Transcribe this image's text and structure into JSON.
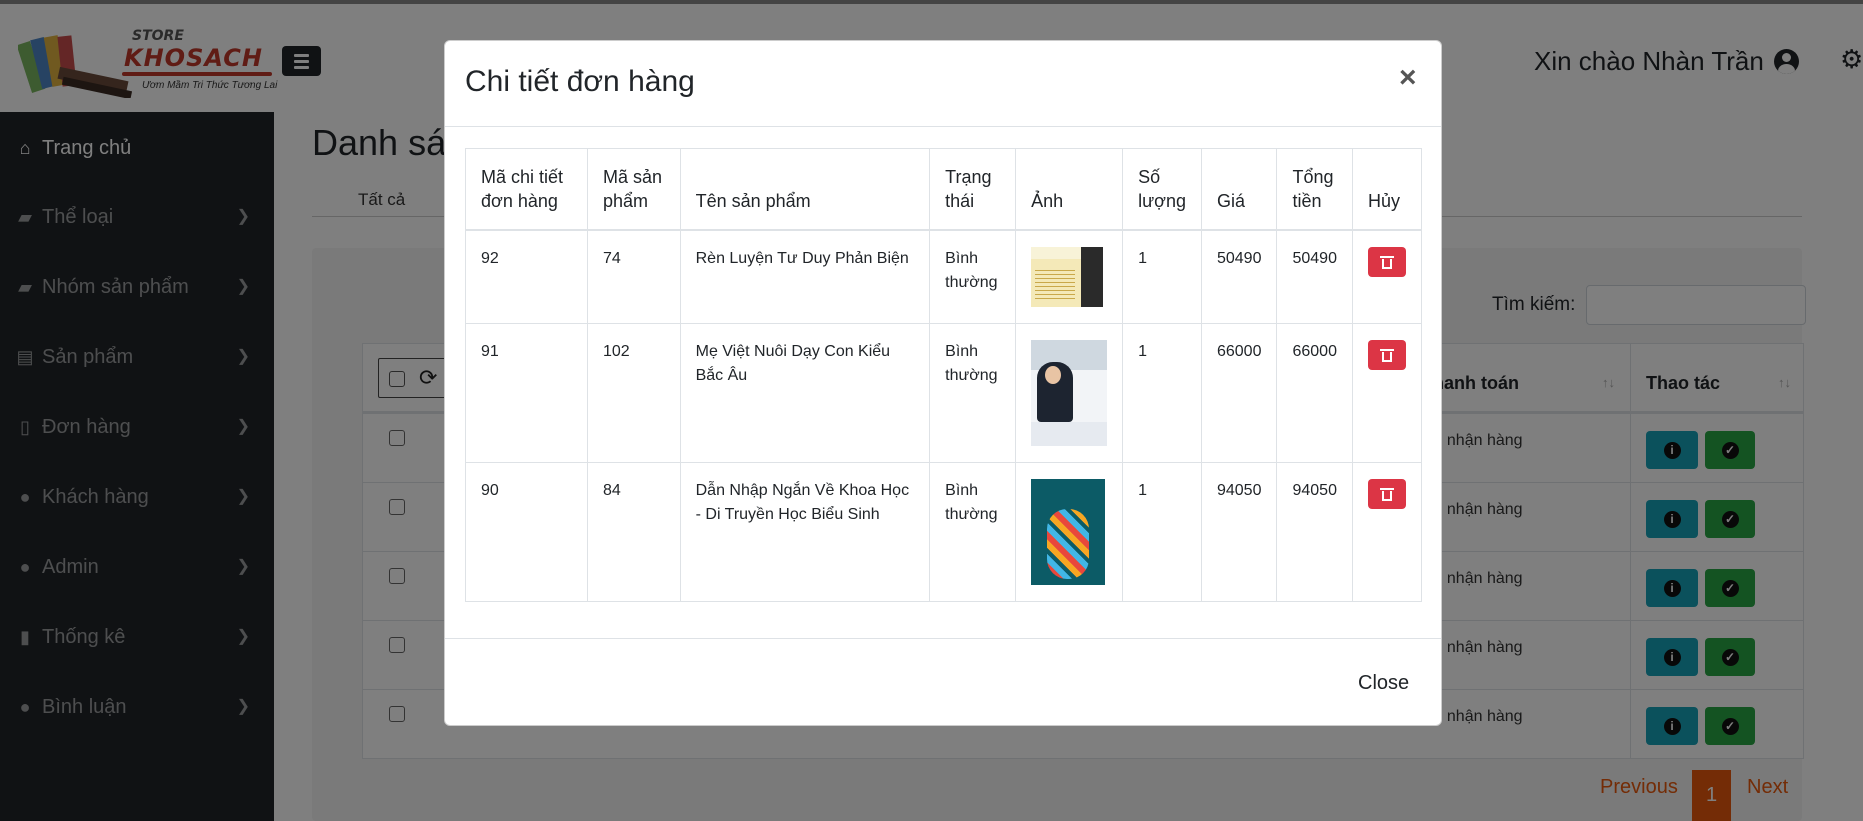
{
  "header": {
    "logo": {
      "store": "STORE",
      "brand": "KHOSACH",
      "slogan": "Ươm Mầm Tri Thức Tương Lai"
    },
    "greeting": "Xin chào Nhàn Trần"
  },
  "sidebar": {
    "items": [
      {
        "label": "Trang chủ",
        "icon": "home-icon",
        "glyph": "⌂"
      },
      {
        "label": "Thể loại",
        "icon": "folder-icon",
        "glyph": "▰"
      },
      {
        "label": "Nhóm sản phẩm",
        "icon": "folder-icon",
        "glyph": "▰"
      },
      {
        "label": "Sản phẩm",
        "icon": "book-icon",
        "glyph": "▤"
      },
      {
        "label": "Đơn hàng",
        "icon": "file-icon",
        "glyph": "▯"
      },
      {
        "label": "Khách hàng",
        "icon": "users-icon",
        "glyph": "●"
      },
      {
        "label": "Admin",
        "icon": "user-icon",
        "glyph": "●"
      },
      {
        "label": "Thống kê",
        "icon": "copy-icon",
        "glyph": "▮"
      },
      {
        "label": "Bình luận",
        "icon": "comment-icon",
        "glyph": "●"
      }
    ]
  },
  "main": {
    "title": "Danh sác",
    "tab_all": "Tất cả",
    "search_label": "Tìm kiếm:",
    "search_value": "",
    "columns": {
      "payment": "c thanh toán",
      "actions": "Thao tác"
    },
    "rows": [
      {
        "payment": "hi nhận hàng"
      },
      {
        "payment": "hi nhận hàng"
      },
      {
        "payment": "hi nhận hàng"
      },
      {
        "payment": "hi nhận hàng"
      },
      {
        "payment": "hi nhận hàng"
      }
    ],
    "pagination": {
      "previous": "Previous",
      "current": "1",
      "next": "Next"
    }
  },
  "modal": {
    "title": "Chi tiết đơn hàng",
    "close_x": "×",
    "close_label": "Close",
    "columns": [
      "Mã chi tiết đơn hàng",
      "Mã sản phẩm",
      "Tên sản phẩm",
      "Trạng thái",
      "Ảnh",
      "Số lượng",
      "Giá",
      "Tổng tiền",
      "Hủy"
    ],
    "rows": [
      {
        "detail_id": "92",
        "product_id": "74",
        "name": "Rèn Luyện Tư Duy Phản Biện",
        "status": "Bình thường",
        "qty": "1",
        "price": "50490",
        "total": "50490"
      },
      {
        "detail_id": "91",
        "product_id": "102",
        "name": "Mẹ Việt Nuôi Dạy Con Kiểu Bắc Âu",
        "status": "Bình thường",
        "qty": "1",
        "price": "66000",
        "total": "66000"
      },
      {
        "detail_id": "90",
        "product_id": "84",
        "name": "Dẫn Nhập Ngắn Về Khoa Học - Di Truyền Học Biểu Sinh",
        "status": "Bình thường",
        "qty": "1",
        "price": "94050",
        "total": "94050"
      }
    ]
  },
  "colors": {
    "sidebar_bg": "#212529",
    "danger": "#dc3545",
    "info": "#17a2b8",
    "success": "#28a745",
    "pager_accent": "#e8590c"
  }
}
